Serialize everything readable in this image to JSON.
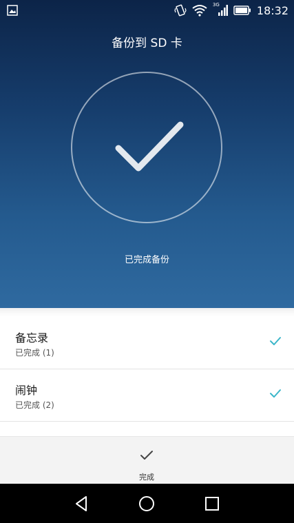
{
  "statusbar": {
    "time": "18:32",
    "network_label": "3G",
    "icons": [
      "gallery-icon",
      "vibrate-icon",
      "wifi-icon",
      "signal-icon",
      "battery-icon"
    ]
  },
  "header": {
    "title": "备份到 SD 卡"
  },
  "status": {
    "done_text": "已完成备份",
    "icon": "checkmark-icon"
  },
  "list": {
    "items": [
      {
        "name": "备忘录",
        "status": "已完成 (1)"
      },
      {
        "name": "闹钟",
        "status": "已完成 (2)"
      }
    ]
  },
  "footer": {
    "done_label": "完成"
  },
  "navbar": {
    "icons": [
      "back-icon",
      "home-icon",
      "recents-icon"
    ]
  },
  "colors": {
    "accent_check": "#3bb6c9",
    "header_top": "#0c2448",
    "header_bottom": "#2f6aa0"
  }
}
